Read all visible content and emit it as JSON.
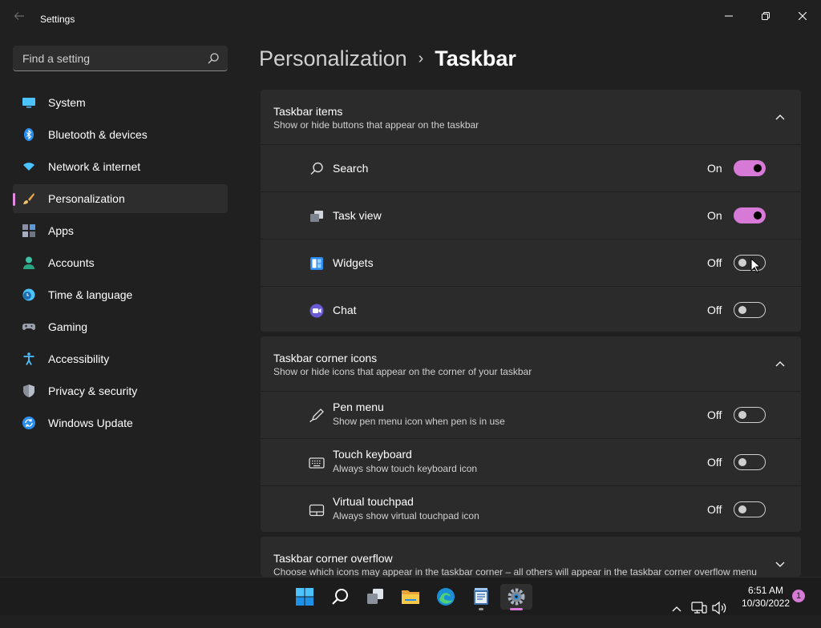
{
  "window": {
    "title": "Settings"
  },
  "search": {
    "placeholder": "Find a setting"
  },
  "nav": {
    "items": [
      {
        "label": "System",
        "icon": "system-icon"
      },
      {
        "label": "Bluetooth & devices",
        "icon": "bluetooth-icon"
      },
      {
        "label": "Network & internet",
        "icon": "wifi-icon"
      },
      {
        "label": "Personalization",
        "icon": "brush-icon",
        "selected": true
      },
      {
        "label": "Apps",
        "icon": "apps-icon"
      },
      {
        "label": "Accounts",
        "icon": "accounts-icon"
      },
      {
        "label": "Time & language",
        "icon": "clock-icon"
      },
      {
        "label": "Gaming",
        "icon": "gamepad-icon"
      },
      {
        "label": "Accessibility",
        "icon": "accessibility-icon"
      },
      {
        "label": "Privacy & security",
        "icon": "shield-icon"
      },
      {
        "label": "Windows Update",
        "icon": "update-icon"
      }
    ]
  },
  "breadcrumb": {
    "parent": "Personalization",
    "separator": "›",
    "current": "Taskbar"
  },
  "sections": {
    "items": {
      "title": "Taskbar items",
      "subtitle": "Show or hide buttons that appear on the taskbar",
      "expanded": true,
      "rows": [
        {
          "label": "Search",
          "state": "On",
          "on": true,
          "icon": "search-icon"
        },
        {
          "label": "Task view",
          "state": "On",
          "on": true,
          "icon": "task-view-icon"
        },
        {
          "label": "Widgets",
          "state": "Off",
          "on": false,
          "icon": "widgets-icon"
        },
        {
          "label": "Chat",
          "state": "Off",
          "on": false,
          "icon": "chat-icon"
        }
      ]
    },
    "corner_icons": {
      "title": "Taskbar corner icons",
      "subtitle": "Show or hide icons that appear on the corner of your taskbar",
      "expanded": true,
      "rows": [
        {
          "label": "Pen menu",
          "sublabel": "Show pen menu icon when pen is in use",
          "state": "Off",
          "on": false,
          "icon": "pen-icon"
        },
        {
          "label": "Touch keyboard",
          "sublabel": "Always show touch keyboard icon",
          "state": "Off",
          "on": false,
          "icon": "keyboard-icon"
        },
        {
          "label": "Virtual touchpad",
          "sublabel": "Always show virtual touchpad icon",
          "state": "Off",
          "on": false,
          "icon": "touchpad-icon"
        }
      ]
    },
    "overflow": {
      "title": "Taskbar corner overflow",
      "subtitle": "Choose which icons may appear in the taskbar corner – all others will appear in the taskbar corner overflow menu",
      "expanded": false
    }
  },
  "taskbar": {
    "apps": [
      "start-icon",
      "search-icon",
      "task-view-icon",
      "file-explorer-icon",
      "edge-icon",
      "notepad-icon",
      "settings-icon"
    ],
    "time": "6:51 AM",
    "date": "10/30/2022",
    "notification_count": "1"
  },
  "colors": {
    "accent": "#d779d6",
    "background": "#202020",
    "card": "#2b2b2b"
  }
}
